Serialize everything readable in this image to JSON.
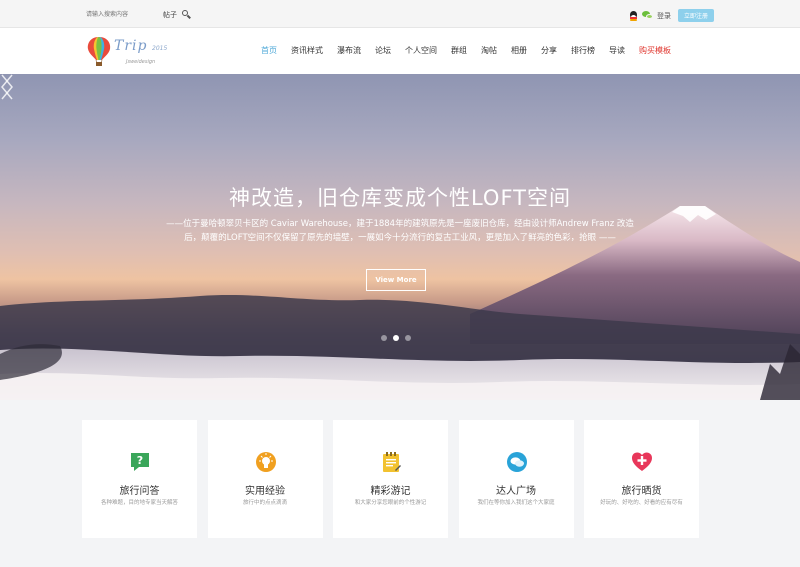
{
  "topbar": {
    "search_placeholder": "请输入搜索内容",
    "search_type": "帖子",
    "login": "登录",
    "register": "立即注册"
  },
  "logo": {
    "text": "Trip",
    "year": "2015",
    "subtitle": "Jsweidesign"
  },
  "nav": {
    "items": [
      {
        "label": "首页"
      },
      {
        "label": "资讯样式"
      },
      {
        "label": "瀑布流"
      },
      {
        "label": "论坛"
      },
      {
        "label": "个人空间"
      },
      {
        "label": "群组"
      },
      {
        "label": "淘帖"
      },
      {
        "label": "相册"
      },
      {
        "label": "分享"
      },
      {
        "label": "排行榜"
      },
      {
        "label": "导读"
      },
      {
        "label": "购买模板"
      }
    ],
    "active_index": 0,
    "highlight_index": 11
  },
  "hero": {
    "title": "神改造，旧仓库变成个性LOFT空间",
    "description": "——位于曼哈顿翠贝卡区的 Caviar Warehouse，建于1884年的建筑原先是一座废旧仓库，经由设计师Andrew Franz 改造后，颠覆的LOFT空间不仅保留了原先的墙壁，一展如今十分流行的复古工业风，更是加入了鲜亮的色彩，抢眼 ——",
    "button": "View More",
    "slide_count": 3,
    "active_slide": 1
  },
  "features": [
    {
      "title": "旅行问答",
      "desc": "各种难题，目的地专家当天解答",
      "icon": "question-bubble-icon",
      "color": "#3aa65a"
    },
    {
      "title": "实用经验",
      "desc": "旅行中的点点滴滴",
      "icon": "lightbulb-icon",
      "color": "#f0a020"
    },
    {
      "title": "精彩游记",
      "desc": "和大家分享您眼前的个性游记",
      "icon": "notepad-icon",
      "color": "#f2c230"
    },
    {
      "title": "达人广场",
      "desc": "我们在等你加入我们这个大家庭",
      "icon": "chat-bubbles-icon",
      "color": "#29a3d8"
    },
    {
      "title": "旅行晒货",
      "desc": "好玩的、好吃的、好看的应有尽有",
      "icon": "plus-heart-icon",
      "color": "#e8375a"
    }
  ]
}
